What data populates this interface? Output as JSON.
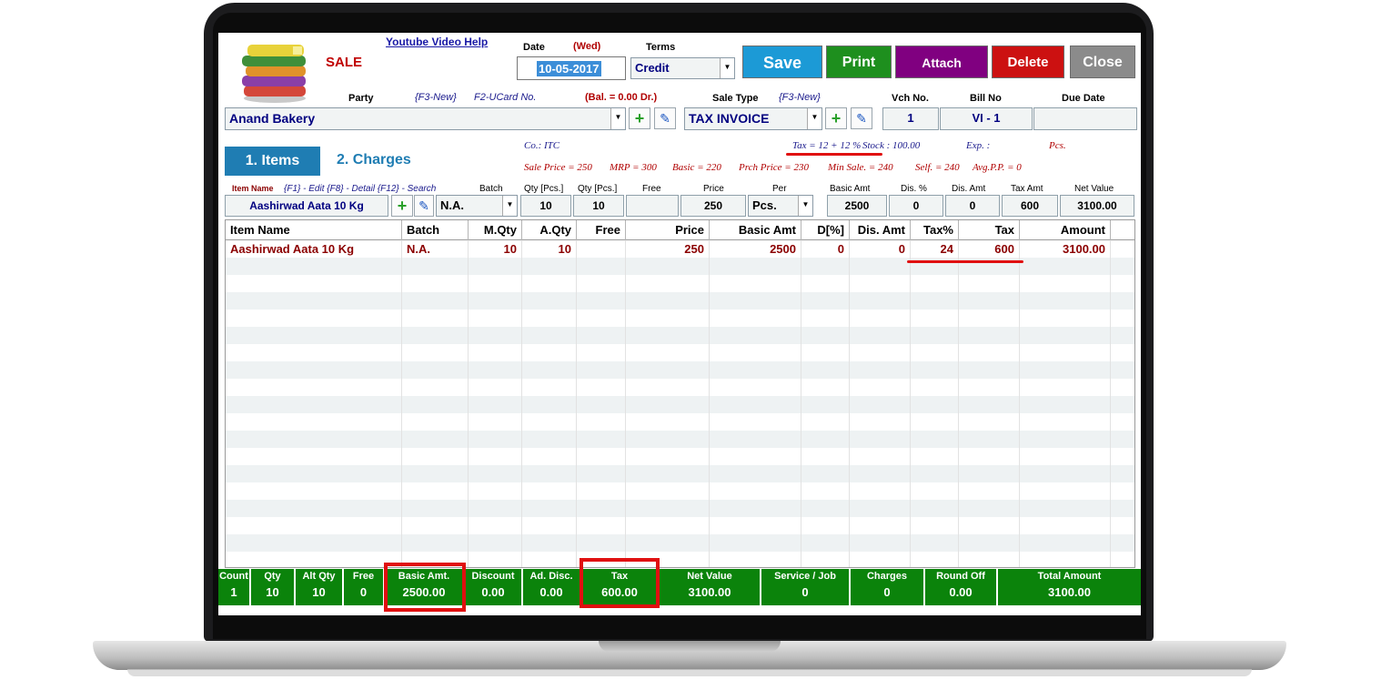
{
  "header": {
    "module": "SALE",
    "help_link": "Youtube Video Help",
    "date_label": "Date",
    "day": "(Wed)",
    "date": "10-05-2017",
    "terms_label": "Terms",
    "terms": "Credit"
  },
  "buttons": {
    "save": "Save",
    "print": "Print",
    "attach": "Attach",
    "delete": "Delete",
    "close": "Close"
  },
  "party": {
    "label": "Party",
    "new_hint": "{F3-New}",
    "ucard_hint": "F2-UCard No.",
    "balance": "(Bal. =  0.00 Dr.)",
    "value": "Anand Bakery"
  },
  "sale_type": {
    "label": "Sale Type",
    "new_hint": "{F3-New}",
    "value": "TAX INVOICE"
  },
  "voucher": {
    "vch_label": "Vch No.",
    "vch_value": "1",
    "bill_label": "Bill No",
    "bill_value": "VI - 1",
    "due_label": "Due Date",
    "due_value": ""
  },
  "tabs": {
    "items": "1. Items",
    "charges": "2. Charges"
  },
  "item_info": {
    "company": "Co.: ITC",
    "tax": "Tax = 12 + 12 %",
    "stock": "Stock : 100.00",
    "exp": "Exp. :",
    "unit": "Pcs.",
    "sale_price": "Sale Price = 250",
    "mrp": "MRP = 300",
    "basic": "Basic = 220",
    "prch_price": "Prch Price = 230",
    "min_sale": "Min Sale. = 240",
    "self": "Self. = 240",
    "avg_pp": "Avg.P.P. = 0"
  },
  "entry": {
    "labels": {
      "item_name": "Item Name",
      "hints": "{F1} - Edit  {F8} - Detail {F12} - Search",
      "batch": "Batch",
      "qty": "Qty [Pcs.]",
      "qty2": "Qty [Pcs.]",
      "free": "Free",
      "price": "Price",
      "per": "Per",
      "basic_amt": "Basic Amt",
      "dis_pct": "Dis. %",
      "dis_amt": "Dis. Amt",
      "tax_amt": "Tax Amt",
      "net_value": "Net Value"
    },
    "values": {
      "item_name": "Aashirwad Aata 10 Kg",
      "batch": "N.A.",
      "qty": "10",
      "qty2": "10",
      "free": "",
      "price": "250",
      "per": "Pcs.",
      "basic_amt": "2500",
      "dis_pct": "0",
      "dis_amt": "0",
      "tax_amt": "600",
      "net_value": "3100.00"
    }
  },
  "grid": {
    "columns": [
      "Item Name",
      "Batch",
      "M.Qty",
      "A.Qty",
      "Free",
      "Price",
      "Basic Amt",
      "D[%]",
      "Dis. Amt",
      "Tax%",
      "Tax",
      "Amount"
    ],
    "rows": [
      [
        "Aashirwad Aata 10 Kg",
        "N.A.",
        "10",
        "10",
        "",
        "250",
        "2500",
        "0",
        "0",
        "24",
        "600",
        "3100.00"
      ]
    ]
  },
  "summary": [
    {
      "label": "Count",
      "value": "1"
    },
    {
      "label": "Qty",
      "value": "10"
    },
    {
      "label": "Alt Qty",
      "value": "10"
    },
    {
      "label": "Free",
      "value": "0"
    },
    {
      "label": "Basic Amt.",
      "value": "2500.00"
    },
    {
      "label": "Discount",
      "value": "0.00"
    },
    {
      "label": "Ad. Disc.",
      "value": "0.00"
    },
    {
      "label": "Tax",
      "value": "600.00"
    },
    {
      "label": "Net Value",
      "value": "3100.00"
    },
    {
      "label": "Service / Job",
      "value": "0"
    },
    {
      "label": "Charges",
      "value": "0"
    },
    {
      "label": "Round Off",
      "value": "0.00"
    },
    {
      "label": "Total Amount",
      "value": "3100.00"
    }
  ],
  "colors": {
    "footer_green": "#0b830b",
    "highlight_red": "#e01010",
    "tab_blue": "#1f7db3"
  }
}
